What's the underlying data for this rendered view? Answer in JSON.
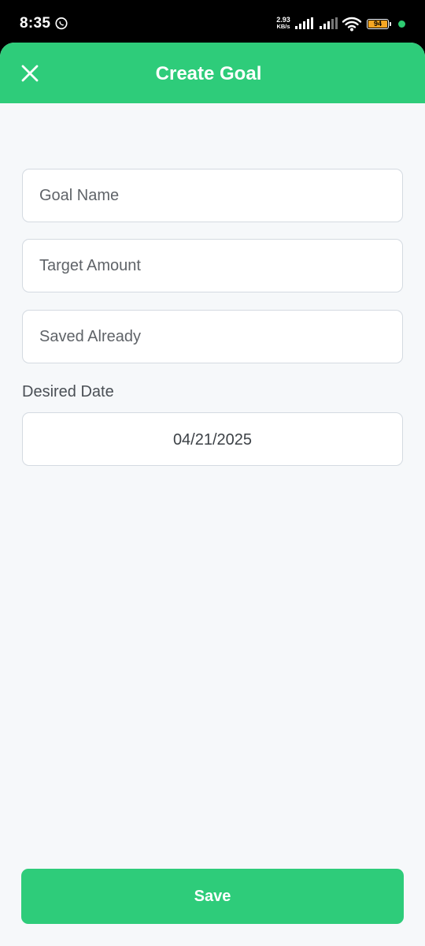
{
  "status_bar": {
    "time": "8:35",
    "net_speed_value": "2.93",
    "net_speed_unit": "KB/s",
    "battery_level": "94",
    "notification_app_icon": "whatsapp-icon",
    "icons": [
      "signal-icon",
      "signal-icon",
      "wifi-icon",
      "battery-icon"
    ]
  },
  "header": {
    "title": "Create Goal",
    "close_icon": "close-icon"
  },
  "form": {
    "goal_name_placeholder": "Goal Name",
    "target_amount_placeholder": "Target Amount",
    "saved_already_placeholder": "Saved Already",
    "date_label": "Desired Date",
    "date_value": "04/21/2025"
  },
  "actions": {
    "save_label": "Save"
  },
  "colors": {
    "accent": "#2ecc7a",
    "background": "#f6f8fa",
    "field_border": "#d4dae1"
  }
}
